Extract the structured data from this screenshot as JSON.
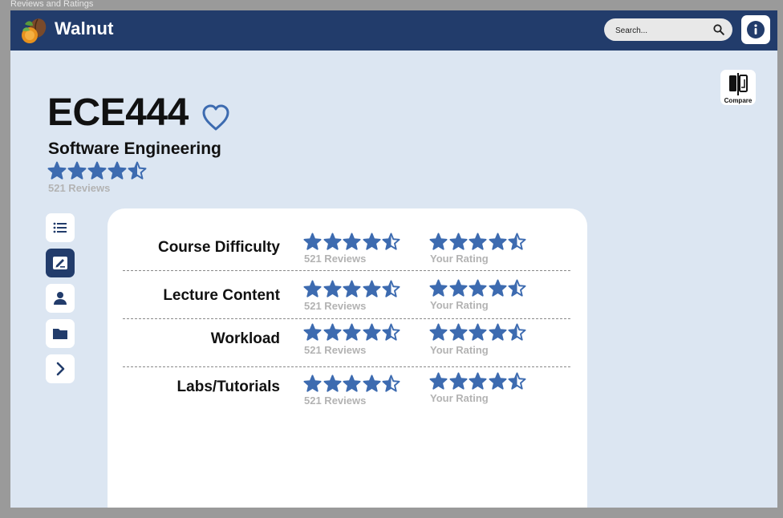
{
  "window": {
    "title": "Reviews and Ratings"
  },
  "header": {
    "brand": "Walnut",
    "search_placeholder": "Search..."
  },
  "compare": {
    "label": "Compare"
  },
  "course": {
    "code": "ECE444",
    "name": "Software Engineering",
    "rating": 4.5,
    "review_count_text": "521 Reviews"
  },
  "sidebar": {
    "items": [
      {
        "icon": "list-icon",
        "active": false
      },
      {
        "icon": "edit-icon",
        "active": true
      },
      {
        "icon": "user-icon",
        "active": false
      },
      {
        "icon": "folder-icon",
        "active": false
      },
      {
        "icon": "chevron-right-icon",
        "active": false
      }
    ]
  },
  "ratings": [
    {
      "label": "Course Difficulty",
      "rating": 4.5,
      "reviews_text": "521 Reviews",
      "your_rating": 4.5,
      "your_rating_text": "Your Rating"
    },
    {
      "label": "Lecture Content",
      "rating": 4.5,
      "reviews_text": "521 Reviews",
      "your_rating": 4.5,
      "your_rating_text": "Your Rating"
    },
    {
      "label": "Workload",
      "rating": 4.5,
      "reviews_text": "521 Reviews",
      "your_rating": 4.5,
      "your_rating_text": "Your Rating"
    },
    {
      "label": "Labs/Tutorials",
      "rating": 4.5,
      "reviews_text": "521 Reviews",
      "your_rating": 4.5,
      "your_rating_text": "Your Rating"
    }
  ],
  "colors": {
    "brand_navy": "#223c6b",
    "star_blue": "#3d6bb0",
    "background": "#dce6f2",
    "muted_text": "#b3b3b3"
  }
}
